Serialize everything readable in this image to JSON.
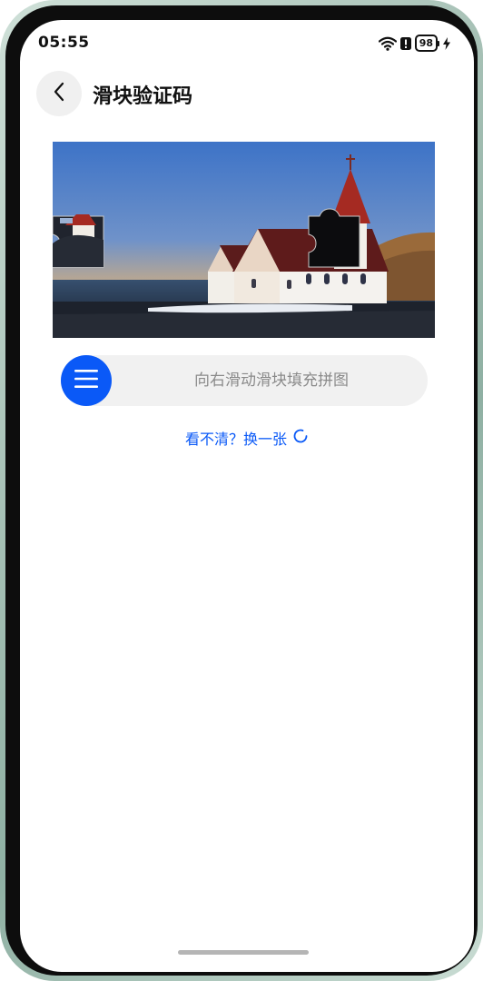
{
  "status_bar": {
    "time": "05:55",
    "battery_level": "98",
    "icons": [
      "wifi-icon",
      "alert-icon",
      "battery-icon",
      "charging-icon"
    ]
  },
  "header": {
    "back_icon": "chevron-left-icon",
    "title": "滑块验证码"
  },
  "captcha": {
    "image_description_icon": "church-landscape-image",
    "piece_icon": "puzzle-piece-icon",
    "gap_icon": "puzzle-gap-icon"
  },
  "slider": {
    "hint": "向右滑动滑块填充拼图",
    "handle_icon": "menu-lines-icon",
    "handle_color": "#0a59f7",
    "progress": 0
  },
  "refresh": {
    "label": "看不清？换一张",
    "icon": "refresh-icon",
    "color": "#0a59f7"
  }
}
